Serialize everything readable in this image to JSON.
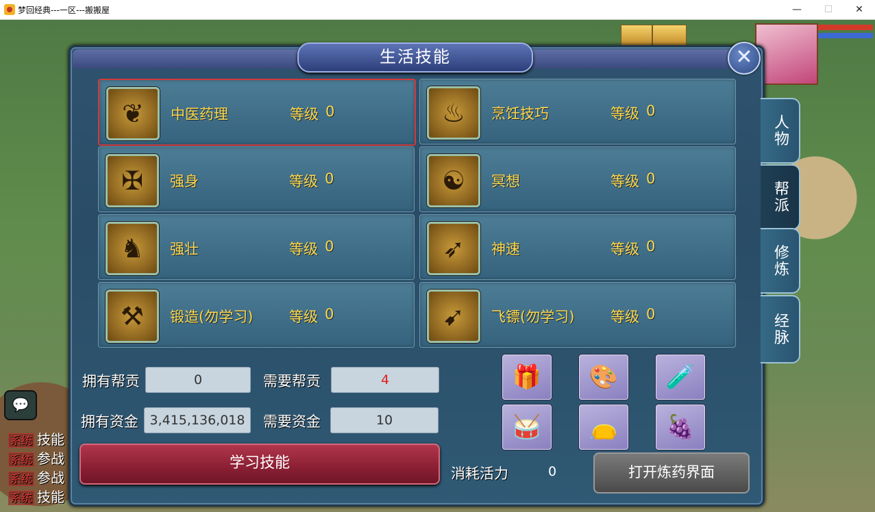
{
  "window": {
    "title": "梦回经典---一区---搬搬屋",
    "minimize": "—",
    "maximize": "☐",
    "close": "✕"
  },
  "chat": {
    "icon": "speech-bubble-icon",
    "lines": [
      {
        "tag": "系统",
        "text": "技能"
      },
      {
        "tag": "系统",
        "text": "参战"
      },
      {
        "tag": "系统",
        "text": "参战"
      },
      {
        "tag": "系统",
        "text": "技能"
      }
    ]
  },
  "panel": {
    "title": "生活技能",
    "close": "✕"
  },
  "skills": [
    {
      "name": "中医药理",
      "level_label": "等级",
      "level": "0",
      "icon": "herb-icon",
      "selected": true
    },
    {
      "name": "烹饪技巧",
      "level_label": "等级",
      "level": "0",
      "icon": "cooking-icon",
      "selected": false
    },
    {
      "name": "强身",
      "level_label": "等级",
      "level": "0",
      "icon": "strength-icon",
      "selected": false
    },
    {
      "name": "冥想",
      "level_label": "等级",
      "level": "0",
      "icon": "meditation-icon",
      "selected": false
    },
    {
      "name": "强壮",
      "level_label": "等级",
      "level": "0",
      "icon": "muscle-icon",
      "selected": false
    },
    {
      "name": "神速",
      "level_label": "等级",
      "level": "0",
      "icon": "speed-icon",
      "selected": false
    },
    {
      "name": "锻造(勿学习)",
      "level_label": "等级",
      "level": "0",
      "icon": "hammer-icon",
      "selected": false
    },
    {
      "name": "飞镖(勿学习)",
      "level_label": "等级",
      "level": "0",
      "icon": "dart-icon",
      "selected": false
    }
  ],
  "tabs": [
    {
      "label": "人物"
    },
    {
      "label": "帮派"
    },
    {
      "label": "修炼"
    },
    {
      "label": "经脉"
    }
  ],
  "stats": {
    "own_contribution_label": "拥有帮贡",
    "own_contribution": "0",
    "need_contribution_label": "需要帮贡",
    "need_contribution": "4",
    "own_funds_label": "拥有资金",
    "own_funds": "3,415,136,018",
    "need_funds_label": "需要资金",
    "need_funds": "10"
  },
  "items": [
    {
      "icon": "jewelry-box-icon",
      "glyph": "🎁"
    },
    {
      "icon": "palette-icon",
      "glyph": "🎨"
    },
    {
      "icon": "potion-bottle-icon",
      "glyph": "🧪"
    },
    {
      "icon": "drum-icon",
      "glyph": "🥁"
    },
    {
      "icon": "pouch-icon",
      "glyph": "👝"
    },
    {
      "icon": "grapes-icon",
      "glyph": "🍇"
    }
  ],
  "actions": {
    "learn": "学习技能",
    "consume_label": "消耗活力",
    "consume_value": "0",
    "open_alchemy": "打开炼药界面"
  }
}
